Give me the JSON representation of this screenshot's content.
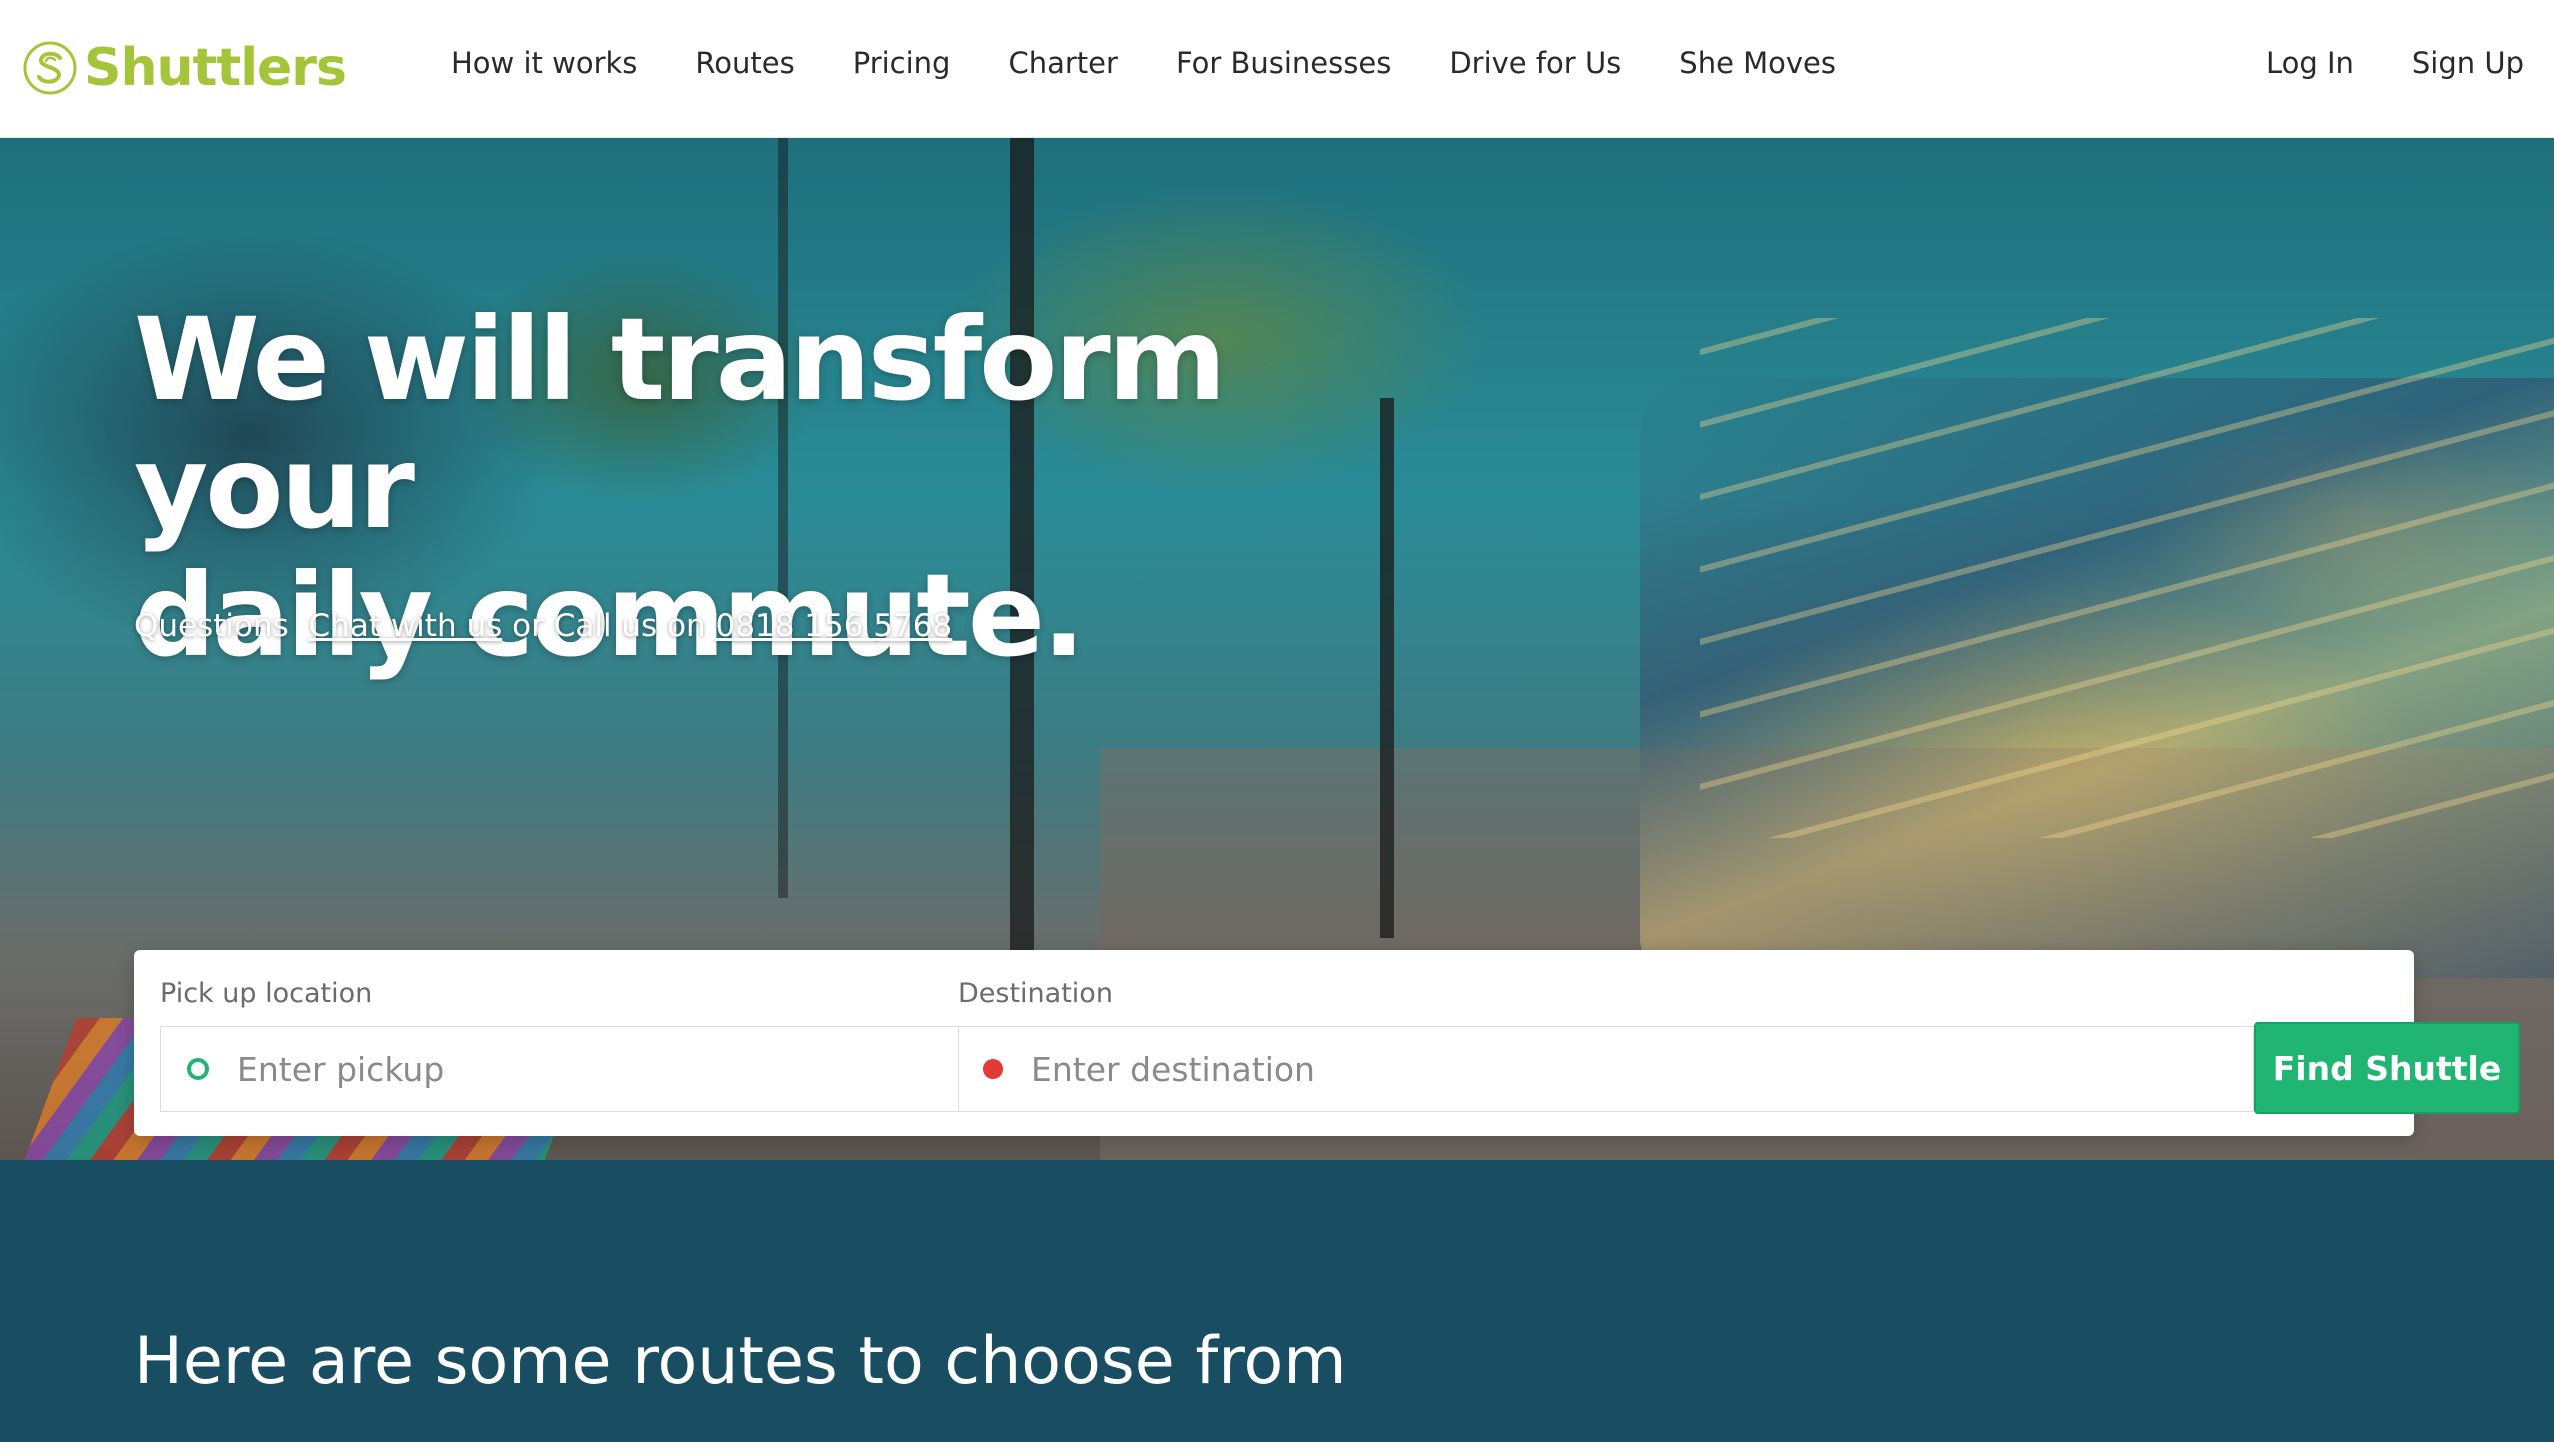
{
  "brand": {
    "name": "Shuttlers",
    "accent": "#a4c43a"
  },
  "nav": {
    "items": [
      {
        "label": "How it works"
      },
      {
        "label": "Routes"
      },
      {
        "label": "Pricing"
      },
      {
        "label": "Charter"
      },
      {
        "label": "For Businesses"
      },
      {
        "label": "Drive for Us"
      },
      {
        "label": "She Moves"
      }
    ],
    "login_label": "Log In",
    "signup_label": "Sign Up"
  },
  "hero": {
    "title_line1": "We will transform your",
    "title_line2": "daily commute.",
    "contact_prefix": "Questions",
    "chat_link": "Chat with us",
    "contact_middle": "or Call us on",
    "phone": "0818 156 5768"
  },
  "search": {
    "pickup_label": "Pick up location",
    "pickup_placeholder": "Enter pickup",
    "destination_label": "Destination",
    "destination_placeholder": "Enter destination",
    "submit_label": "Find Shuttle",
    "submit_color": "#21b573"
  },
  "routes_section": {
    "title": "Here are some routes to choose from",
    "background": "#184d62"
  }
}
